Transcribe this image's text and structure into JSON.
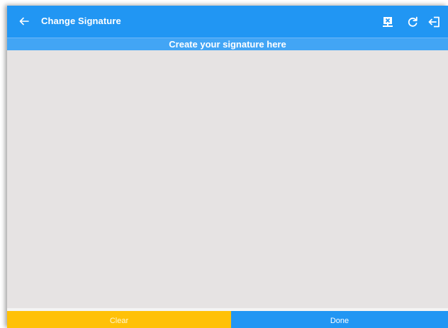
{
  "appbar": {
    "title": "Change Signature",
    "back_icon": "arrow-back-icon",
    "actions": [
      {
        "icon": "cancel-screen-icon"
      },
      {
        "icon": "refresh-icon"
      },
      {
        "icon": "logout-icon"
      }
    ]
  },
  "subheader": {
    "text": "Create your signature here"
  },
  "buttons": {
    "clear_label": "Clear",
    "done_label": "Done"
  },
  "colors": {
    "primary": "#2196f3",
    "subheader": "#42a5f5",
    "canvas": "#e6e3e3",
    "accent": "#ffc107"
  }
}
